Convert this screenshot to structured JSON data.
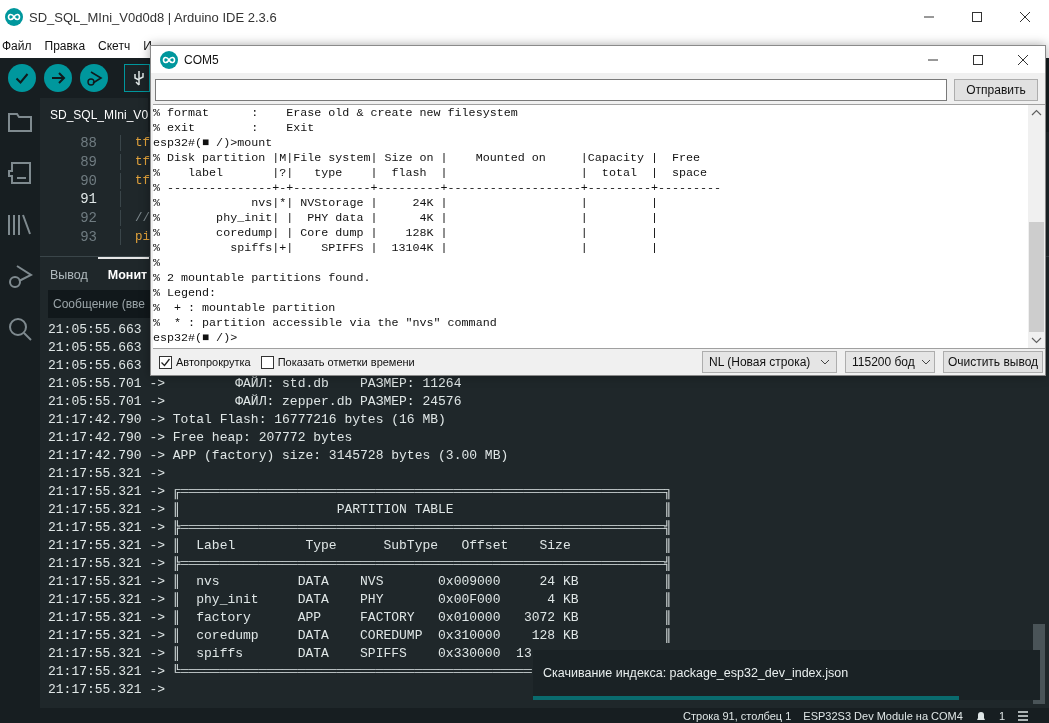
{
  "ide": {
    "title": "SD_SQL_MIni_V0d0d8 | Arduino IDE 2.3.6",
    "menu": [
      "Файл",
      "Правка",
      "Скетч",
      "И"
    ],
    "editor_tab": "SD_SQL_MIni_V0",
    "code_lines": [
      {
        "number": "88",
        "code": "tf",
        "kind": "identifier",
        "current": false
      },
      {
        "number": "89",
        "code": "tf",
        "kind": "identifier",
        "current": false
      },
      {
        "number": "90",
        "code": "tf",
        "kind": "identifier",
        "current": false
      },
      {
        "number": "91",
        "current": true
      },
      {
        "number": "92",
        "code": "//",
        "kind": "comment",
        "current": false
      },
      {
        "number": "93",
        "code": "pi",
        "kind": "identifier",
        "current": false
      }
    ],
    "panel_tabs": [
      {
        "label": "Вывод",
        "selected": false
      },
      {
        "label": "Монит",
        "selected": true
      }
    ],
    "message_field": {
      "placeholder": "Сообщение (вве"
    },
    "output_lines": [
      "21:05:55.663",
      "21:05:55.663",
      "21:05:55.663",
      "21:05:55.701 ->         ФАЙЛ: std.db    РАЗМЕР: 11264",
      "21:05:55.701 ->         ФАЙЛ: zepper.db РАЗМЕР: 24576",
      "21:17:42.790 -> Total Flash: 16777216 bytes (16 MB)",
      "21:17:42.790 -> Free heap: 207772 bytes",
      "21:17:42.790 -> APP (factory) size: 3145728 bytes (3.00 MB)",
      "21:17:55.321 ->",
      "21:17:55.321 -> ╔══════════════════════════════════════════════════════════════╗",
      "21:17:55.321 -> ║                    PARTITION TABLE                           ║",
      "21:17:55.321 -> ╠══════════════════════════════════════════════════════════════╣",
      "21:17:55.321 -> ║  Label         Type      SubType   Offset    Size            ║",
      "21:17:55.321 -> ╠══════════════════════════════════════════════════════════════╣",
      "21:17:55.321 -> ║  nvs          DATA    NVS       0x009000     24 KB           ║",
      "21:17:55.321 -> ║  phy_init     DATA    PHY       0x00F000      4 KB           ║",
      "21:17:55.321 -> ║  factory      APP     FACTORY   0x010000   3072 KB           ║",
      "21:17:55.321 -> ║  coredump     DATA    COREDUMP  0x310000    128 KB           ║",
      "21:17:55.321 -> ║  spiffs       DATA    SPIFFS    0x330000  13",
      "21:17:55.321 -> ╚═════════════════════════════════════════════",
      "21:17:55.321 ->"
    ],
    "status_bar": {
      "position": "Строка 91, столбец 1",
      "board": "ESP32S3 Dev Module на COM4",
      "notifications": "1"
    }
  },
  "serial_window": {
    "title": "COM5",
    "send_button": "Отправить",
    "lines": [
      "% format      :    Erase old & create new filesystem",
      "% exit        :    Exit",
      "esp32#(■ /)>mount",
      "% Disk partition |M|File system| Size on |    Mounted on     |Capacity |  Free",
      "%    label       |?|   type    |  flash  |                   |  total  |  space",
      "% ---------------+-+-----------+---------+-------------------+---------+---------",
      "%             nvs|*| NVStorage |     24K |                   |         |",
      "%        phy_init| |  PHY data |      4K |                   |         |",
      "%        coredump| | Core dump |    128K |                   |         |",
      "%          spiffs|+|    SPIFFS |  13104K |                   |         |",
      "%",
      "% 2 mountable partitions found.",
      "% Legend:",
      "%  + : mountable partition",
      "%  * : partition accessible via the \"nvs\" command",
      "esp32#(■ /)>"
    ],
    "autoscroll": {
      "label": "Автопрокрутка",
      "checked": true
    },
    "timestamps": {
      "label": "Показать отметки времени",
      "checked": false
    },
    "line_ending": "NL (Новая строка)",
    "baud_rate": "115200 бод",
    "clear_button": "Очистить вывод"
  },
  "toast": {
    "message": "Скачивание индекса: package_esp32_dev_index.json",
    "level": 0.84
  }
}
